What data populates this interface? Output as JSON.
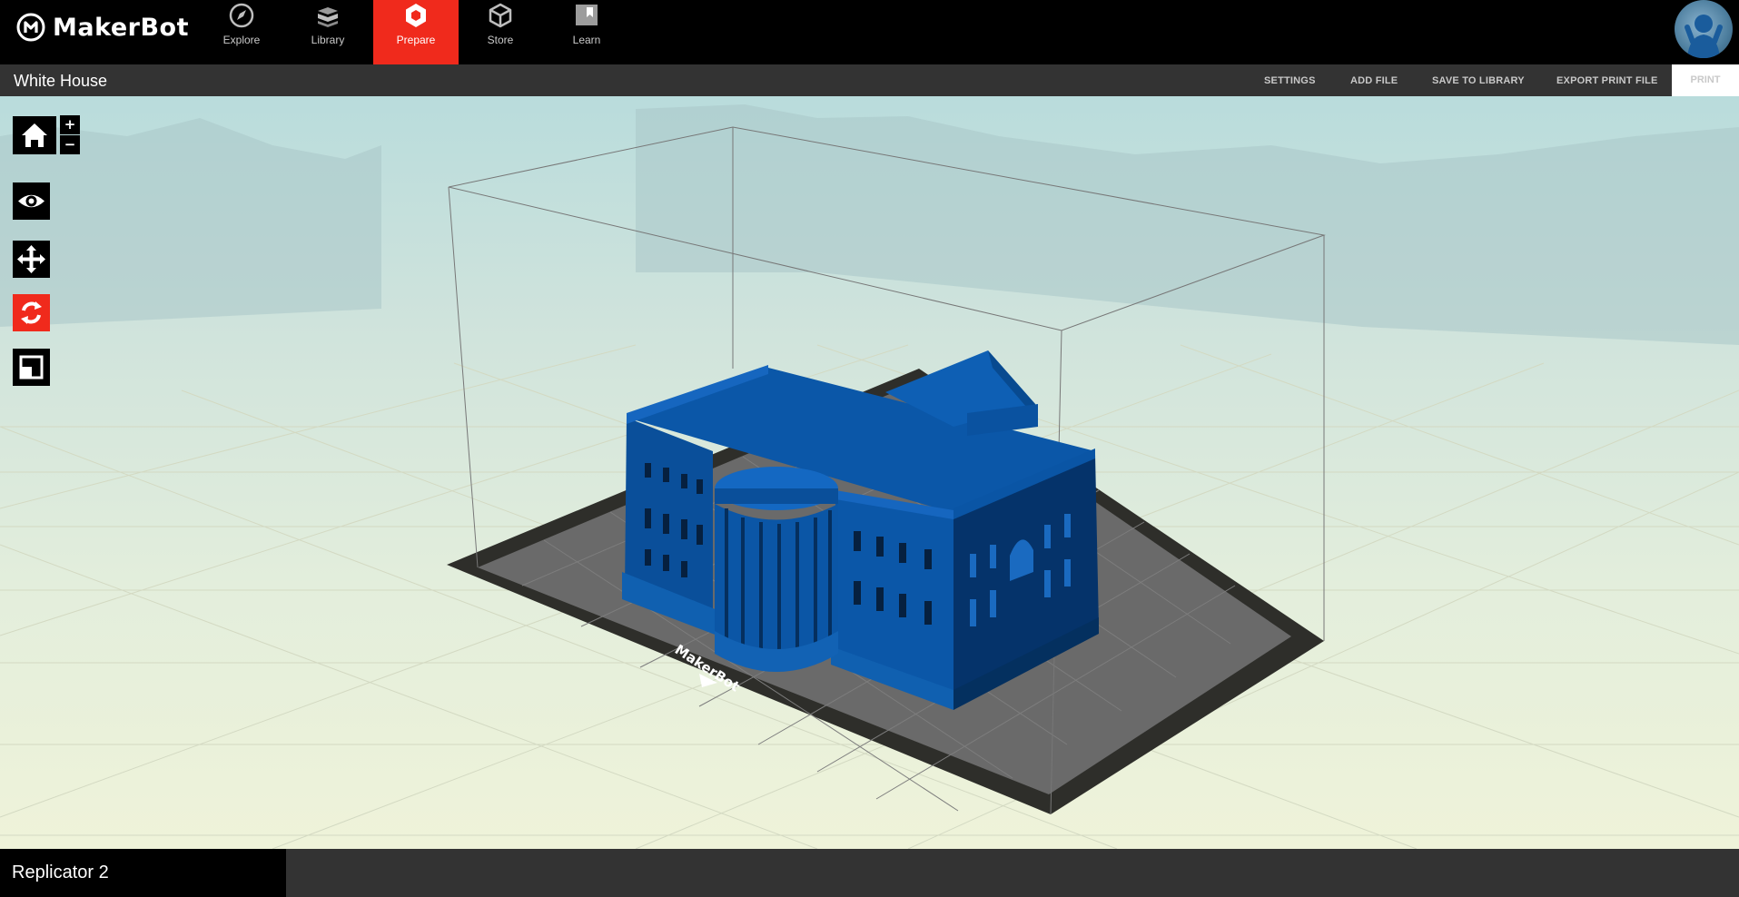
{
  "app": {
    "brand": "MakerBot"
  },
  "nav": {
    "tabs": [
      {
        "label": "Explore",
        "icon": "compass-icon"
      },
      {
        "label": "Library",
        "icon": "library-icon"
      },
      {
        "label": "Prepare",
        "icon": "prepare-icon",
        "active": true
      },
      {
        "label": "Store",
        "icon": "store-box-icon"
      },
      {
        "label": "Learn",
        "icon": "bookmark-icon"
      }
    ]
  },
  "titlebar": {
    "title": "White House",
    "settings": "SETTINGS",
    "add_file": "ADD FILE",
    "save_to_library": "SAVE TO LIBRARY",
    "export": "EXPORT PRINT FILE",
    "print": "PRINT"
  },
  "viewport": {
    "zoom_in": "+",
    "zoom_out": "−",
    "tools": [
      "home-icon",
      "eye-icon",
      "move-icon",
      "rotate-icon",
      "scale-icon"
    ],
    "active_tool": "rotate",
    "plate_label": "MakerBot",
    "model_color": "#0b57a8"
  },
  "bottombar": {
    "printer": "Replicator 2"
  },
  "colors": {
    "accent": "#f02a1c",
    "bar": "#333333",
    "model": "#0b57a8"
  }
}
